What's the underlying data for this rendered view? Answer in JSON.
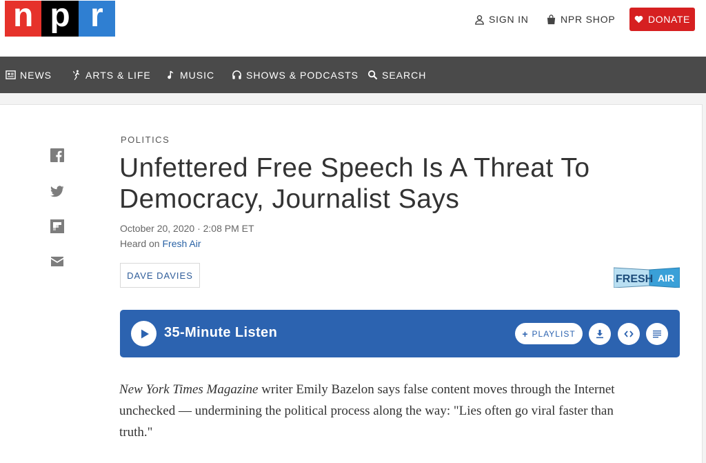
{
  "logo": {
    "letters": [
      "n",
      "p",
      "r"
    ]
  },
  "header": {
    "sign_in": "SIGN IN",
    "shop": "NPR SHOP",
    "donate": "DONATE"
  },
  "nav": {
    "items": [
      {
        "label": "NEWS",
        "icon": "news-icon"
      },
      {
        "label": "ARTS & LIFE",
        "icon": "arts-dancer-icon"
      },
      {
        "label": "MUSIC",
        "icon": "music-note-icon"
      },
      {
        "label": "SHOWS & PODCASTS",
        "icon": "headphones-icon"
      },
      {
        "label": "SEARCH",
        "icon": "search-icon"
      }
    ]
  },
  "share": [
    "facebook-icon",
    "twitter-icon",
    "flipboard-icon",
    "email-icon"
  ],
  "article": {
    "slug": "POLITICS",
    "title": "Unfettered Free Speech Is A Threat To Democracy, Journalist Says",
    "date": "October 20, 2020 · 2:08 PM ET",
    "heard_prefix": "Heard on ",
    "heard_show": "Fresh Air",
    "author": "DAVE DAVIES",
    "show_logo_text": [
      "FRESH",
      "AIR"
    ],
    "body_italic": "New York Times Magazine",
    "body_rest": " writer Emily Bazelon says false content moves through the Internet unchecked — undermining the political process along the way: \"Lies often go viral faster than truth.\""
  },
  "player": {
    "listen_label": "35-Minute Listen",
    "playlist_label": "PLAYLIST",
    "accent": "#2c63b0"
  },
  "colors": {
    "nav_bg": "#4a4a4a",
    "donate_bg": "#d62021",
    "link": "#2962a5"
  }
}
